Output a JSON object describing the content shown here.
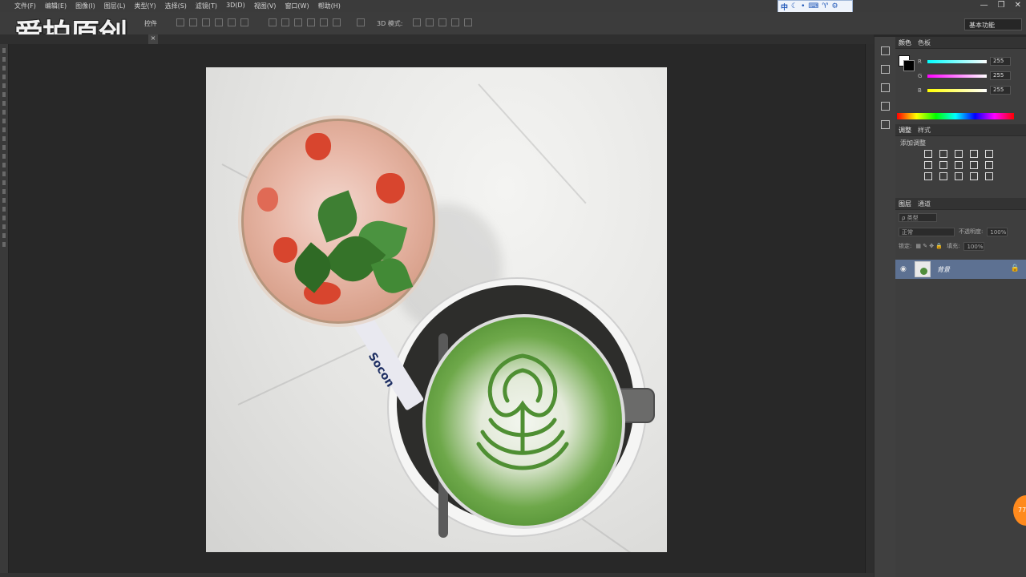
{
  "menu": [
    "文件(F)",
    "编辑(E)",
    "图像(I)",
    "图层(L)",
    "类型(Y)",
    "选择(S)",
    "滤镜(T)",
    "3D(D)",
    "视图(V)",
    "窗口(W)",
    "帮助(H)"
  ],
  "window_controls": {
    "minimize": "—",
    "restore": "❐",
    "close": "✕"
  },
  "ime": {
    "lang": "中",
    "icons": [
      "moon-icon",
      "dot-icon",
      "keyboard-icon",
      "shirt-icon",
      "gear-icon"
    ]
  },
  "options_bar": {
    "auto_select_label": "控件",
    "mode_3d_label": "3D 模式:"
  },
  "workspace": {
    "label": "基本功能"
  },
  "watermark": "爱拍原创",
  "panels": {
    "color": {
      "tabs": [
        "颜色",
        "色板"
      ],
      "channels": [
        {
          "label": "R",
          "value": "255"
        },
        {
          "label": "G",
          "value": "255"
        },
        {
          "label": "B",
          "value": "255"
        }
      ]
    },
    "adjustments": {
      "tabs": [
        "调整",
        "样式"
      ],
      "title": "添加调整"
    },
    "layers": {
      "tabs": [
        "图层",
        "通道"
      ],
      "filter_label": "ρ 类型",
      "blend_mode": "正常",
      "opacity_label": "不透明度:",
      "opacity_value": "100%",
      "lock_label": "锁定:",
      "fill_label": "填充:",
      "fill_value": "100%",
      "layer_name": "背景"
    }
  },
  "badge": {
    "text": "77"
  },
  "photo": {
    "straw_text": "Socon"
  },
  "colors": {
    "accent": "#5d7192",
    "badge": "#ff8a1d",
    "matcha": "#4c8b2e"
  }
}
